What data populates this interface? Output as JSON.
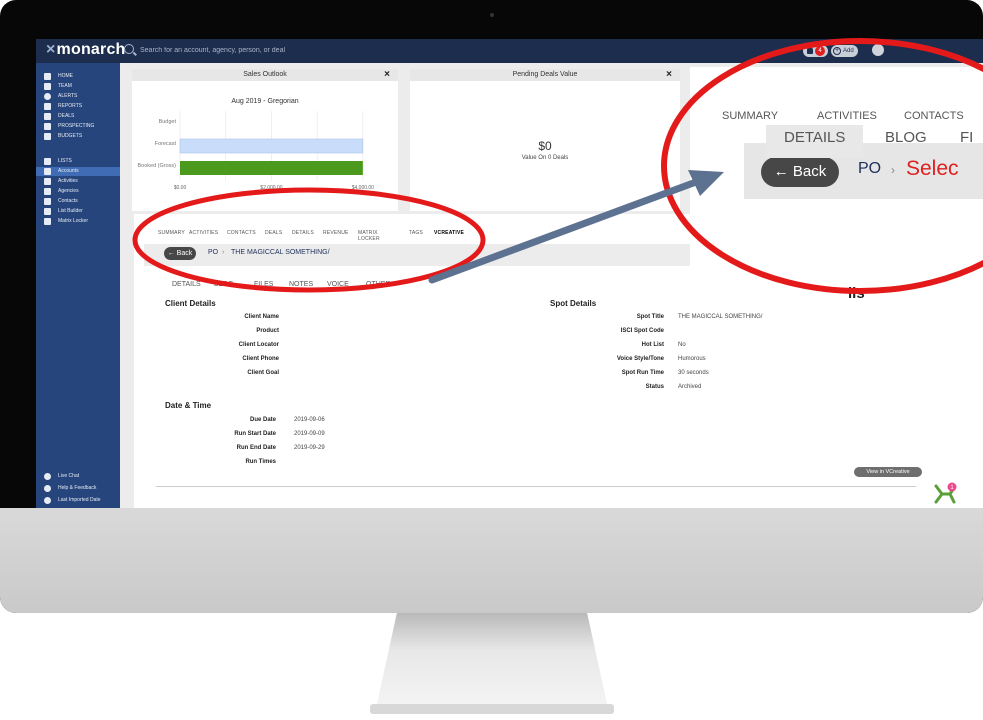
{
  "app": {
    "logo_prefix": "×",
    "logo_text": "monarch",
    "search_placeholder": "Search for an account, agency, person, or deal",
    "alert_count": "4",
    "add_label": "Add"
  },
  "sidebar": {
    "items": [
      {
        "label": "HOME",
        "icon": "home-icon"
      },
      {
        "label": "TEAM",
        "icon": "team-icon"
      },
      {
        "label": "ALERTS",
        "icon": "alert-icon"
      },
      {
        "label": "REPORTS",
        "icon": "reports-icon"
      },
      {
        "label": "DEALS",
        "icon": "dollar-icon"
      },
      {
        "label": "PROSPECTING",
        "icon": "prospecting-icon"
      },
      {
        "label": "BUDGETS",
        "icon": "budgets-icon"
      }
    ],
    "lists_header": "LISTS",
    "list_items": [
      {
        "label": "Accounts",
        "active": true
      },
      {
        "label": "Activities",
        "active": false
      },
      {
        "label": "Agencies",
        "active": false
      },
      {
        "label": "Contacts",
        "active": false
      },
      {
        "label": "List Builder",
        "active": false
      },
      {
        "label": "Matrix Locker",
        "active": false
      }
    ],
    "bottom_items": [
      {
        "label": "Live Chat",
        "icon": "chat-icon"
      },
      {
        "label": "Help & Feedback",
        "icon": "help-icon"
      },
      {
        "label": "Last Imported Date",
        "icon": "info-icon"
      }
    ]
  },
  "sales_outlook": {
    "title": "Sales Outlook",
    "close": "×"
  },
  "pending_deals": {
    "title": "Pending Deals Value",
    "close": "×",
    "value": "$0",
    "subtitle": "Value On 0 Deals"
  },
  "chart_data": {
    "type": "bar",
    "orientation": "horizontal",
    "title": "Aug 2019 - Gregorian",
    "categories": [
      "Budget",
      "Forecast",
      "Booked (Gross)"
    ],
    "values": [
      0,
      4000,
      4000
    ],
    "colors": [
      "#c9ddfa",
      "#c9ddfa",
      "#4c9a1d"
    ],
    "x_tick_labels": [
      "$0.00",
      "$2,000.00",
      "$4,000.00"
    ],
    "xlim": [
      0,
      4200
    ]
  },
  "detail": {
    "tabs": [
      "SUMMARY",
      "ACTIVITIES",
      "CONTACTS",
      "DEALS",
      "DETAILS",
      "REVENUE",
      "MATRIX LOCKER",
      "TAGS",
      "VCREATIVE"
    ],
    "active_tab": "VCREATIVE",
    "back_label": "← Back",
    "crumb_po": "PO",
    "crumb_sep": "›",
    "crumb_title": "THE MAGICCAL SOMETHING/",
    "subtabs": [
      "DETAILS",
      "BLOG",
      "FILES",
      "NOTES",
      "VOICE",
      "OTHER"
    ],
    "client_details_title": "Client Details",
    "client_fields": [
      {
        "label": "Client Name",
        "value": ""
      },
      {
        "label": "Product",
        "value": ""
      },
      {
        "label": "Client Locator",
        "value": ""
      },
      {
        "label": "Client Phone",
        "value": ""
      },
      {
        "label": "Client Goal",
        "value": ""
      }
    ],
    "spot_details_title": "Spot Details",
    "spot_fields": [
      {
        "label": "Spot Title",
        "value": "THE MAGICCAL SOMETHING/"
      },
      {
        "label": "ISCI Spot Code",
        "value": ""
      },
      {
        "label": "Hot List",
        "value": "No"
      },
      {
        "label": "Voice Style/Tone",
        "value": "Humorous"
      },
      {
        "label": "Spot Run Time",
        "value": "30 seconds"
      },
      {
        "label": "Status",
        "value": "Archived"
      }
    ],
    "date_time_title": "Date & Time",
    "date_fields": [
      {
        "label": "Due Date",
        "value": "2019-09-06"
      },
      {
        "label": "Run Start Date",
        "value": "2019-09-09"
      },
      {
        "label": "Run End Date",
        "value": "2019-09-29"
      },
      {
        "label": "Run Times",
        "value": ""
      }
    ],
    "view_vcreative": "View in VCreative"
  },
  "zoom": {
    "tabs": [
      "SUMMARY",
      "ACTIVITIES",
      "CONTACTS"
    ],
    "back_label": "← Back",
    "crumb_po": "PO",
    "crumb_sep": "›",
    "crumb_title": "Selec",
    "subtabs": [
      "DETAILS",
      "BLOG",
      "FI"
    ],
    "cut_text": "ils"
  },
  "notification_badge": "1",
  "colors": {
    "topbar": "#1d2d4d",
    "sidebar": "#26457c",
    "sidebar_active": "#3f6cb5",
    "callout_red": "#e41a1a",
    "arrow": "#5d7190"
  }
}
